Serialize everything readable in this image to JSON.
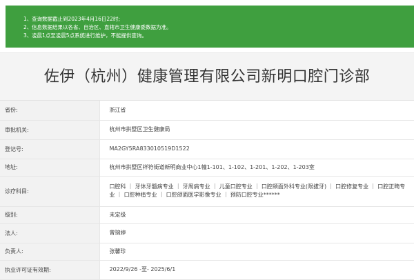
{
  "notice": {
    "lines": [
      {
        "num": "1、",
        "text": "查询数据截止到2023年4月16日22时;"
      },
      {
        "num": "2、",
        "text": "信息数据结果以各省、自治区、直辖市卫生健康委数据为准。"
      },
      {
        "num": "3、",
        "text": "凌晨1点至凌晨5点系统进行维护，不能提供查询。"
      }
    ]
  },
  "title": "佐伊（杭州）健康管理有限公司新明口腔门诊部",
  "rows": [
    {
      "label": "省份:",
      "value": "浙江省"
    },
    {
      "label": "审批机关:",
      "value": "杭州市拱墅区卫生健康局"
    },
    {
      "label": "登记号:",
      "value": "MA2GY5RA833010519D1522"
    },
    {
      "label": "地址:",
      "value": "杭州市拱墅区祥符街道新明商业中心1幢1-101、1-102、1-201、1-202、1-203室"
    },
    {
      "label": "诊疗科目:",
      "value": "口腔科 ｜ 牙体牙髓病专业 ｜ 牙周病专业 ｜ 儿童口腔专业 ｜ 口腔颌面外科专业(限拔牙) ｜ 口腔修复专业 ｜ 口腔正畸专业 ｜ 口腔种植专业 ｜ 口腔颌面医学影像专业 ｜ 预防口腔专业******"
    },
    {
      "label": "级别:",
      "value": "未定级"
    },
    {
      "label": "法人:",
      "value": "曾琬婷"
    },
    {
      "label": "负责人:",
      "value": "张馨珍"
    },
    {
      "label": "执业许可证有效期:",
      "value": "2022/9/26 -至- 2025/6/1"
    }
  ],
  "colors": {
    "notice_bg": "#3f9f3f",
    "label_bg": "#f2f2f2",
    "title_bg": "#f4f4f4"
  }
}
